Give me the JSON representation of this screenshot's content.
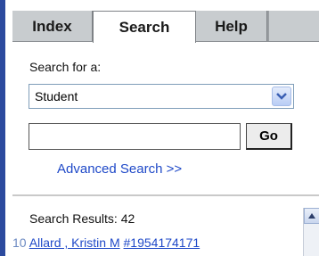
{
  "tabs": [
    {
      "label": "Index"
    },
    {
      "label": "Search"
    },
    {
      "label": "Help"
    }
  ],
  "search": {
    "label": "Search for a:",
    "type_selected": "Student",
    "query_value": "",
    "go_label": "Go",
    "advanced_link": "Advanced Search >>"
  },
  "results": {
    "label": "Search Results: 42",
    "rows": [
      {
        "number": "10",
        "name": "Allard , Kristin M",
        "id": "#1954174171"
      }
    ]
  },
  "colors": {
    "accent_rail": "#2c4a9e",
    "link": "#1f49c8",
    "tab_inactive": "#c8cccf"
  },
  "icons": {
    "select_arrow": "chevron-down-icon",
    "scroll_up": "arrow-up-icon"
  }
}
